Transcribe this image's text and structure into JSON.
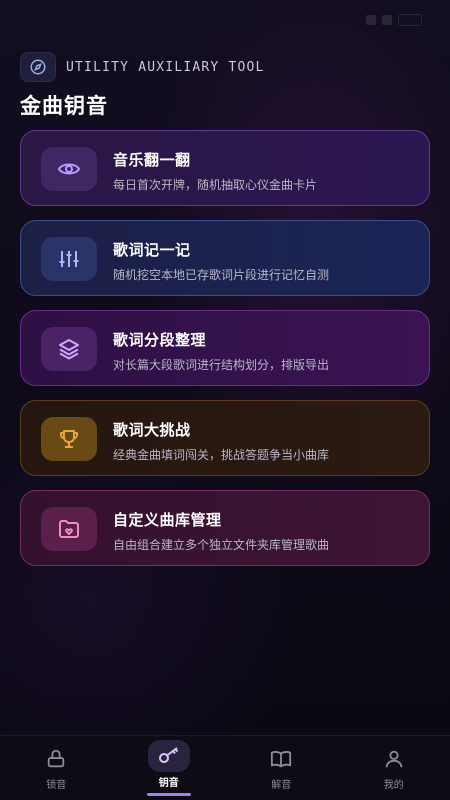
{
  "header": {
    "subtitle": "UTILITY AUXILIARY TOOL",
    "title": "金曲钥音",
    "icon": "compass-icon"
  },
  "cards": [
    {
      "title": "音乐翻一翻",
      "desc": "每日首次开牌，随机抽取心仪金曲卡片",
      "icon": "eye-icon",
      "accent": "#b79cff"
    },
    {
      "title": "歌词记一记",
      "desc": "随机挖空本地已存歌词片段进行记忆自测",
      "icon": "sliders-icon",
      "accent": "#a9b7ff"
    },
    {
      "title": "歌词分段整理",
      "desc": "对长篇大段歌词进行结构划分，排版导出",
      "icon": "layers-icon",
      "accent": "#d2a6ff"
    },
    {
      "title": "歌词大挑战",
      "desc": "经典金曲填词闯关，挑战答题争当小曲库",
      "icon": "trophy-icon",
      "accent": "#e2a93a"
    },
    {
      "title": "自定义曲库管理",
      "desc": "自由组合建立多个独立文件夹库管理歌曲",
      "icon": "folder-heart-icon",
      "accent": "#f08bc8"
    }
  ],
  "tabs": [
    {
      "label": "锁音",
      "icon": "lock-icon",
      "active": false
    },
    {
      "label": "钥音",
      "icon": "key-icon",
      "active": true
    },
    {
      "label": "解音",
      "icon": "book-icon",
      "active": false
    },
    {
      "label": "我的",
      "icon": "user-icon",
      "active": false
    }
  ],
  "colors": {
    "background": "#0d0b17",
    "active_tab": "#a77ef0"
  }
}
